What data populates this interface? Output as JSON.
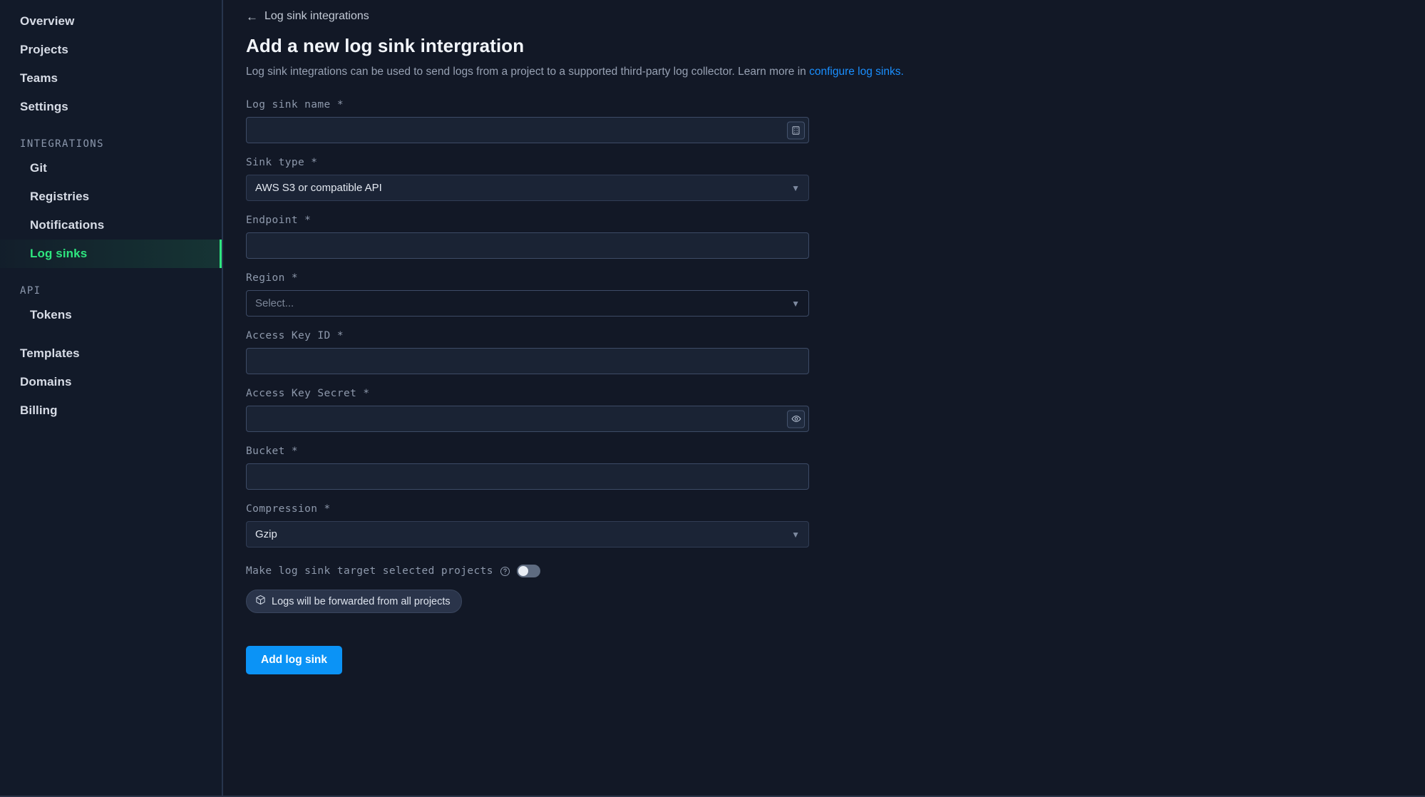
{
  "sidebar": {
    "items": [
      {
        "label": "Overview",
        "type": "top",
        "active": false
      },
      {
        "label": "Projects",
        "type": "top",
        "active": false
      },
      {
        "label": "Teams",
        "type": "top",
        "active": false
      },
      {
        "label": "Settings",
        "type": "top",
        "active": false
      }
    ],
    "section_integrations": "INTEGRATIONS",
    "integrations": [
      {
        "label": "Git",
        "active": false
      },
      {
        "label": "Registries",
        "active": false
      },
      {
        "label": "Notifications",
        "active": false
      },
      {
        "label": "Log sinks",
        "active": true
      }
    ],
    "section_api": "API",
    "api": [
      {
        "label": "Tokens",
        "active": false
      }
    ],
    "bottom": [
      {
        "label": "Templates",
        "active": false
      },
      {
        "label": "Domains",
        "active": false
      },
      {
        "label": "Billing",
        "active": false
      }
    ]
  },
  "main": {
    "breadcrumb": "Log sink integrations",
    "title": "Add a new log sink intergration",
    "description_before_link": "Log sink integrations can be used to send logs from a project to a supported third-party log collector. Learn more in ",
    "description_link": "configure log sinks.",
    "form": {
      "name": {
        "label": "Log sink name *",
        "value": "",
        "placeholder": ""
      },
      "sink_type": {
        "label": "Sink type *",
        "value": "AWS S3 or compatible API"
      },
      "endpoint": {
        "label": "Endpoint *",
        "value": "",
        "placeholder": ""
      },
      "region": {
        "label": "Region *",
        "value": "Select..."
      },
      "access_key_id": {
        "label": "Access Key ID *",
        "value": "",
        "placeholder": ""
      },
      "access_key_secret": {
        "label": "Access Key Secret *",
        "value": "",
        "placeholder": ""
      },
      "bucket": {
        "label": "Bucket *",
        "value": "",
        "placeholder": ""
      },
      "compression": {
        "label": "Compression *",
        "value": "Gzip"
      },
      "target_toggle": {
        "label": "Make log sink target selected projects",
        "state": "off"
      },
      "forward_badge": "Logs will be forwarded from all projects",
      "submit_label": "Add log sink"
    }
  },
  "colors": {
    "accent_green": "#2ee67f",
    "link_blue": "#1a8fff",
    "button_blue": "#0b93f6",
    "sidebar_bg": "#121a29",
    "main_bg": "#121826"
  }
}
